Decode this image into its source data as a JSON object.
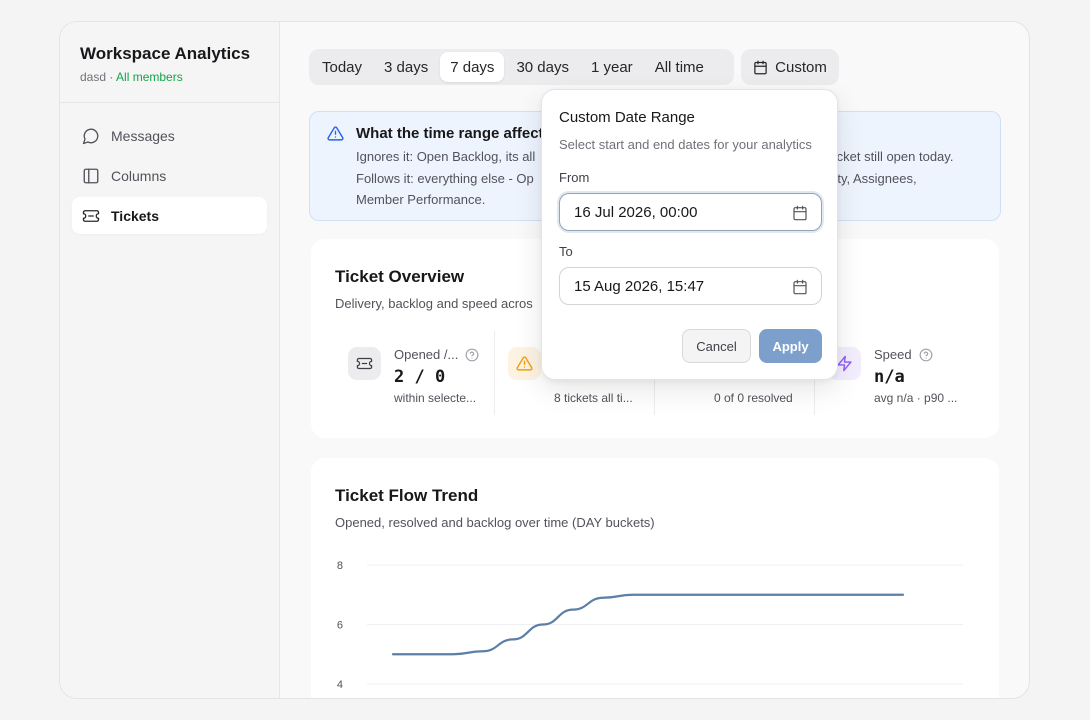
{
  "sidebar": {
    "title": "Workspace Analytics",
    "workspace": "dasd",
    "separator": " · ",
    "scope": "All members",
    "items": [
      {
        "label": "Messages",
        "icon": "message-circle-icon"
      },
      {
        "label": "Columns",
        "icon": "columns-icon"
      },
      {
        "label": "Tickets",
        "icon": "ticket-icon",
        "active": true
      }
    ]
  },
  "range": {
    "options": [
      "Today",
      "3 days",
      "7 days",
      "30 days",
      "1 year",
      "All time"
    ],
    "selected": "7 days",
    "custom_label": "Custom"
  },
  "info": {
    "title": "What the time range affect",
    "line1_left": "Ignores it: Open Backlog, its all",
    "line1_right": "y ticket still open today.",
    "line2_left": "Follows it: everything else - Op",
    "line2_right": "iority, Assignees,",
    "line3": "Member Performance."
  },
  "overview": {
    "title": "Ticket Overview",
    "subtitle": "Delivery, backlog and speed acros",
    "metrics": [
      {
        "label": "Opened /...",
        "value": "2 / 0",
        "note": "within selecte...",
        "icon": "ticket-icon",
        "color": "#52525b",
        "bg": "#f1f1f3"
      },
      {
        "label": "",
        "value": "",
        "note": "8 tickets all ti...",
        "icon": "alert-triangle-icon",
        "color": "#f59e0b",
        "bg": "#fdf3e3"
      },
      {
        "label": "",
        "value": "",
        "note": "0 of 0 resolved",
        "icon": "",
        "color": "#3b82f6",
        "bg": "#eef4fd"
      },
      {
        "label": "Speed",
        "value": "n/a",
        "note": "avg n/a · p90 ...",
        "icon": "zap-icon",
        "color": "#8b5cf6",
        "bg": "#f3eefd"
      }
    ]
  },
  "trend": {
    "title": "Ticket Flow Trend",
    "subtitle": "Opened, resolved and backlog over time (DAY buckets)"
  },
  "chart_data": {
    "type": "line",
    "title": "Ticket Flow Trend",
    "y_ticks": [
      4,
      6,
      8
    ],
    "ylim": [
      4,
      8
    ],
    "grid": true,
    "series": [
      {
        "values": [
          5,
          5,
          5,
          5.1,
          5.5,
          6,
          6.5,
          6.9,
          7,
          7,
          7,
          7,
          7,
          7,
          7,
          7,
          7,
          7
        ],
        "color": "#5b7fa6"
      }
    ]
  },
  "popover": {
    "title": "Custom Date Range",
    "subtitle": "Select start and end dates for your analytics",
    "from_label": "From",
    "from_value": "16 Jul 2026, 00:00",
    "to_label": "To",
    "to_value": "15 Aug 2026, 15:47",
    "cancel": "Cancel",
    "apply": "Apply"
  }
}
